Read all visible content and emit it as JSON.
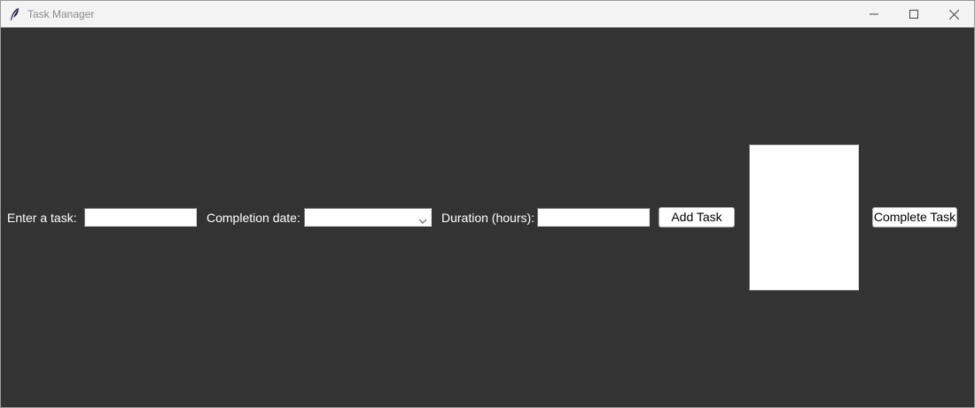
{
  "window": {
    "title": "Task Manager",
    "minimize_icon": "minimize-icon",
    "maximize_icon": "maximize-icon",
    "close_icon": "close-icon",
    "app_icon": "feather-icon"
  },
  "form": {
    "task_label": "Enter a task:",
    "task_value": "",
    "date_label": "Completion date:",
    "date_selected": "",
    "duration_label": "Duration (hours):",
    "duration_value": "",
    "add_button": "Add Task",
    "complete_button": "Complete Task"
  },
  "task_list": {
    "items": []
  },
  "colors": {
    "background": "#333333",
    "label_text": "#ffffff",
    "titlebar": "#f3f3f3"
  }
}
